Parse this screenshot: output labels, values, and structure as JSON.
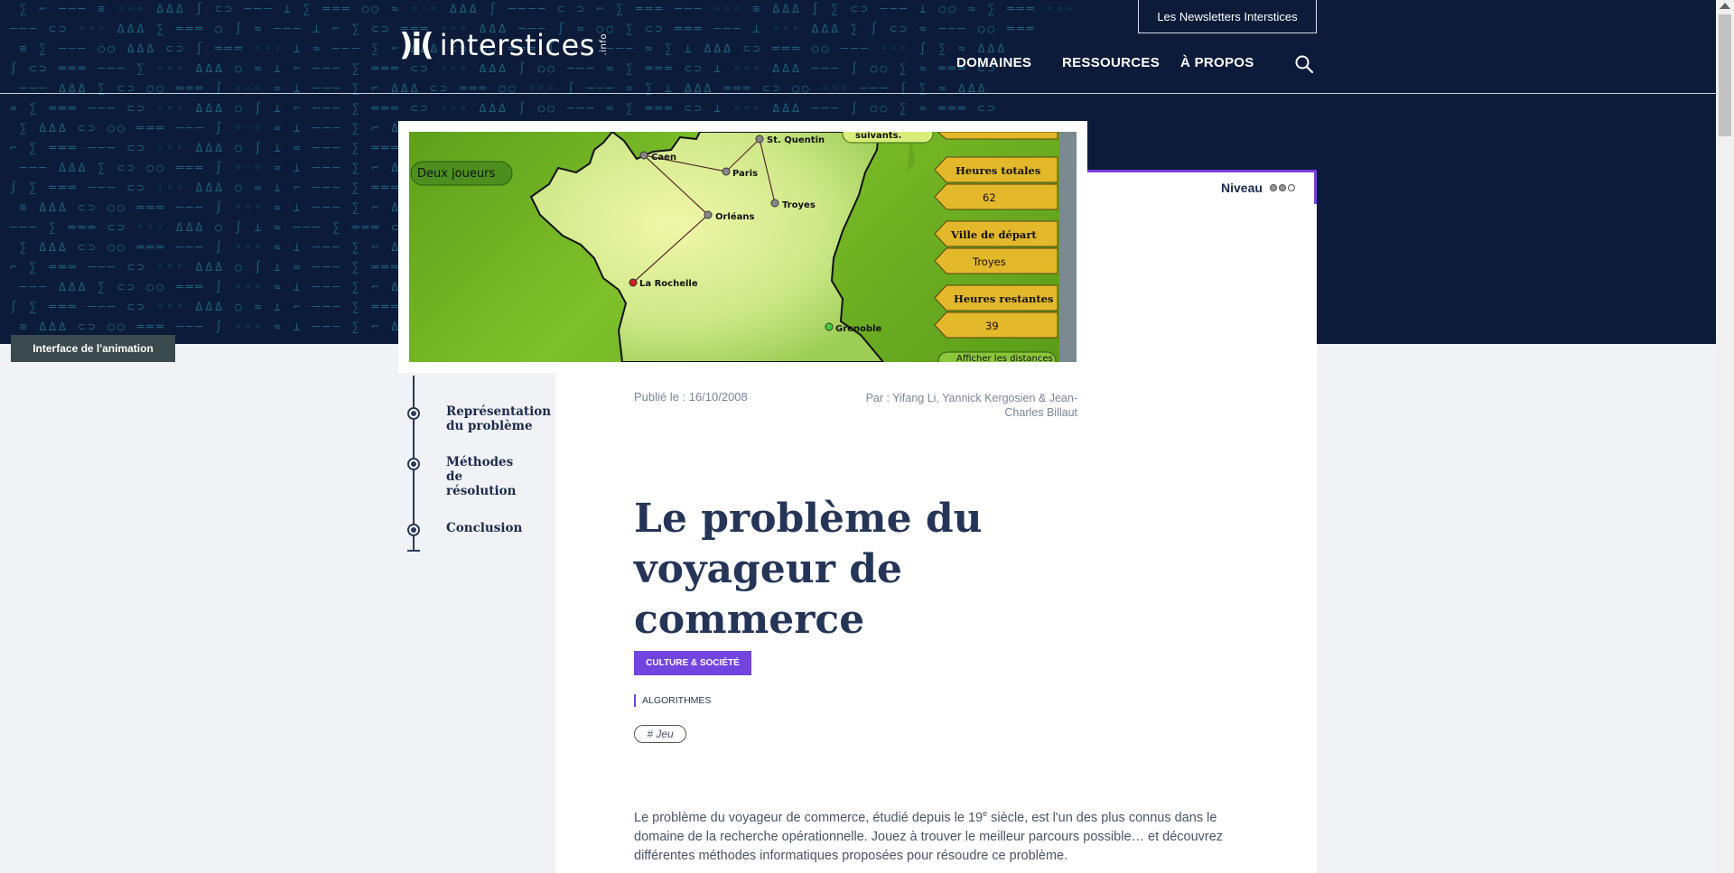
{
  "header": {
    "logo_mark": ")i(",
    "logo_text": "interstices",
    "logo_suffix": ".info",
    "newsletter_label": "Les Newsletters Interstices",
    "nav": [
      "DOMAINES",
      "RESSOURCES",
      "À PROPOS"
    ],
    "search_icon": "search-icon"
  },
  "niveau": {
    "label": "Niveau",
    "level": 2,
    "max": 3
  },
  "hero": {
    "caption": "Interface de l'animation",
    "buttons": {
      "two_players": "Deux joueurs",
      "next": "suivants.",
      "show_distances": "Afficher les distances"
    },
    "cities": [
      "Caen",
      "Paris",
      "St. Quentin",
      "Troyes",
      "Orléans",
      "La Rochelle",
      "Grenoble"
    ],
    "panels": [
      {
        "label": "Heures totales",
        "value": "62"
      },
      {
        "label": "Ville de départ",
        "value": "Troyes"
      },
      {
        "label": "Heures restantes",
        "value": "39"
      }
    ]
  },
  "toc": [
    "Représentation du problème",
    "Méthodes de résolution",
    "Conclusion"
  ],
  "article": {
    "published": "Publié le : 16/10/2008",
    "authors": "Par : Yifang Li, Yannick Kergosien & Jean-Charles Billaut",
    "title": "Le problème du voyageur de commerce",
    "category": "CULTURE & SOCIÉTÉ",
    "domain": "ALGORITHMES",
    "tag": "# Jeu",
    "intro_before": "Le problème du voyageur de commerce, étudié depuis le 19",
    "intro_sup": "e",
    "intro_after": " siècle, est l'un des plus connus dans le domaine de la recherche opérationnelle. Jouez à trouver le meilleur parcours possible… et découvrez différentes méthodes informatiques proposées pour résoudre ce problème."
  },
  "colors": {
    "band": "#0c1b39",
    "accent": "#7345e0",
    "cyan": "#2bb7c7"
  }
}
